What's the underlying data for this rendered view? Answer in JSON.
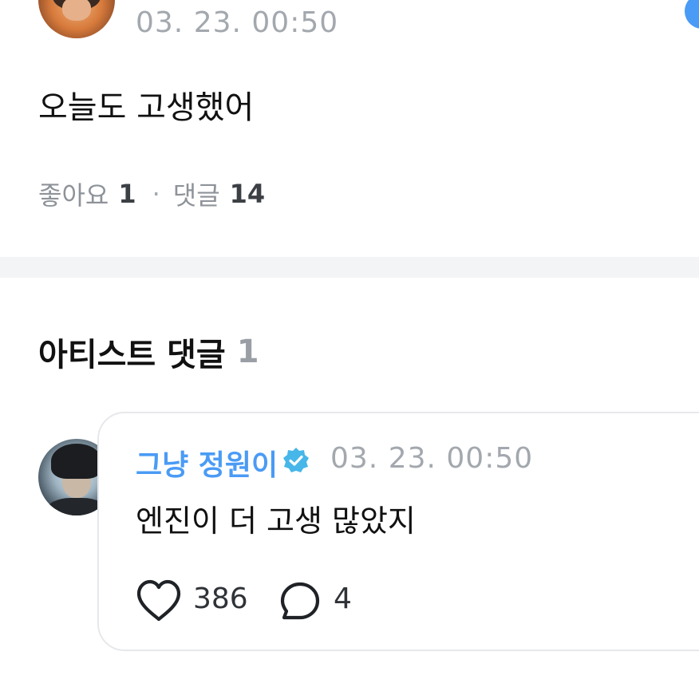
{
  "post": {
    "time": "03. 23. 00:50",
    "text": "오늘도 고생했어",
    "likes_label": "좋아요",
    "likes_count": "1",
    "separator": "·",
    "comments_label": "댓글",
    "comments_count": "14"
  },
  "artist_comments": {
    "title": "아티스트 댓글",
    "count": "1",
    "items": [
      {
        "author": "그냥 정원이",
        "verified_icon": "verified-badge-icon",
        "time": "03. 23. 00:50",
        "text": "엔진이 더 고생 많았지",
        "likes": "386",
        "replies": "4"
      }
    ]
  },
  "colors": {
    "accent": "#4a9bf5",
    "verified": "#47b6e9",
    "muted_text": "#a3a8ae",
    "divider": "#f3f4f6"
  }
}
